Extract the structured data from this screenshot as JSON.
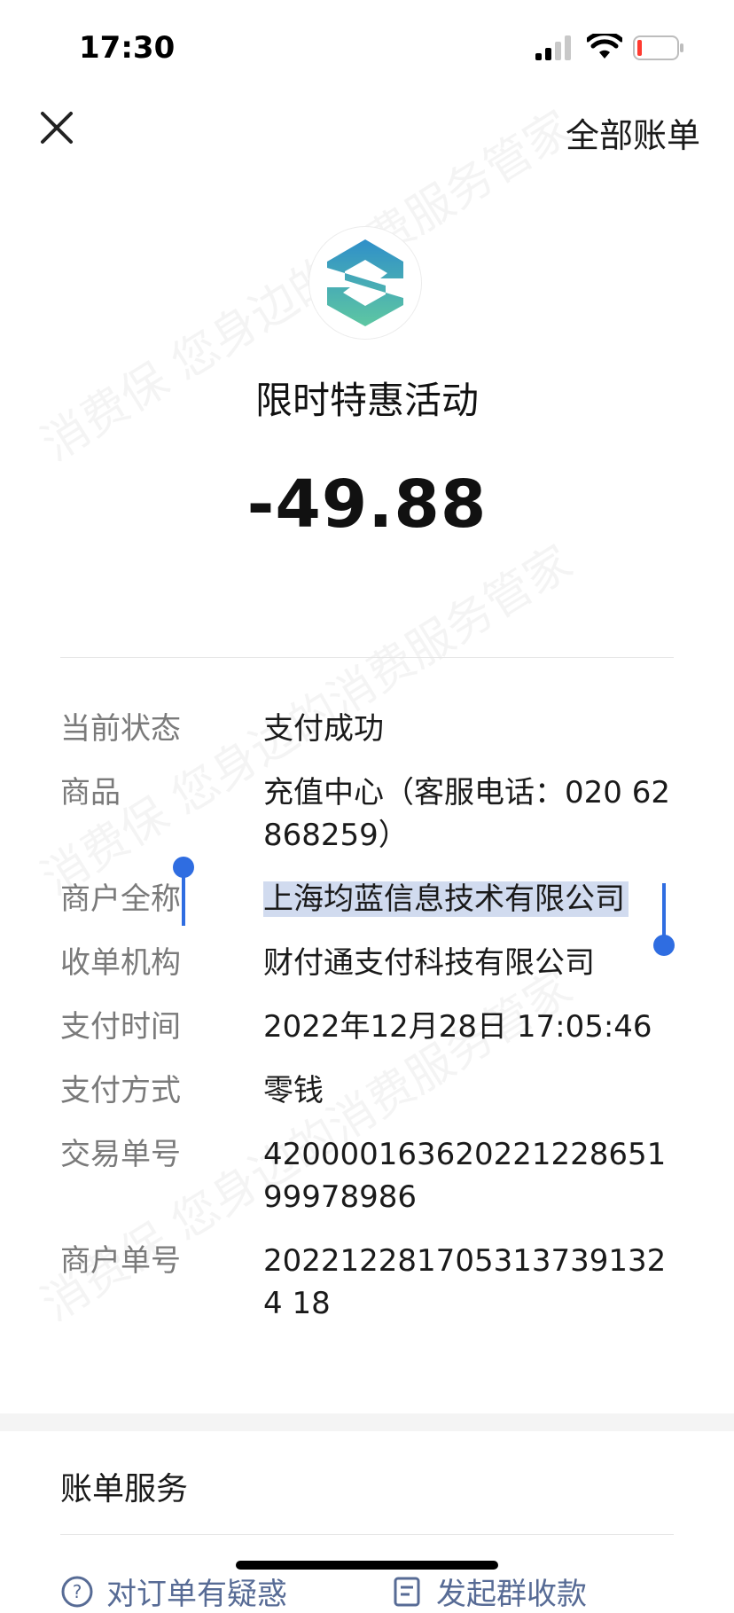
{
  "status_bar": {
    "time": "17:30"
  },
  "nav": {
    "all_bills_label": "全部账单"
  },
  "header": {
    "merchant_title": "限时特惠活动",
    "amount": "-49.88"
  },
  "details": [
    {
      "label": "当前状态",
      "value": "支付成功"
    },
    {
      "label": "商品",
      "value": "充值中心（客服电话：020 62868259）"
    },
    {
      "label": "商户全称",
      "value": "上海均蓝信息技术有限公司"
    },
    {
      "label": "收单机构",
      "value": "财付通支付科技有限公司"
    },
    {
      "label": "支付时间",
      "value": "2022年12月28日 17:05:46"
    },
    {
      "label": "支付方式",
      "value": "零钱"
    },
    {
      "label": "交易单号",
      "value": "42000016362022122865199978986"
    },
    {
      "label": "商户单号",
      "value": "2022122817053137391324 18"
    }
  ],
  "services": {
    "title": "账单服务",
    "doubt_label": "对订单有疑惑",
    "collect_label": "发起群收款"
  },
  "watermark_text": "消费保 您身边的消费服务管家",
  "colors": {
    "link": "#576b95",
    "selection": "#2f6de1",
    "logo_top": "#33a3c6",
    "logo_bottom": "#6ccb9c"
  }
}
